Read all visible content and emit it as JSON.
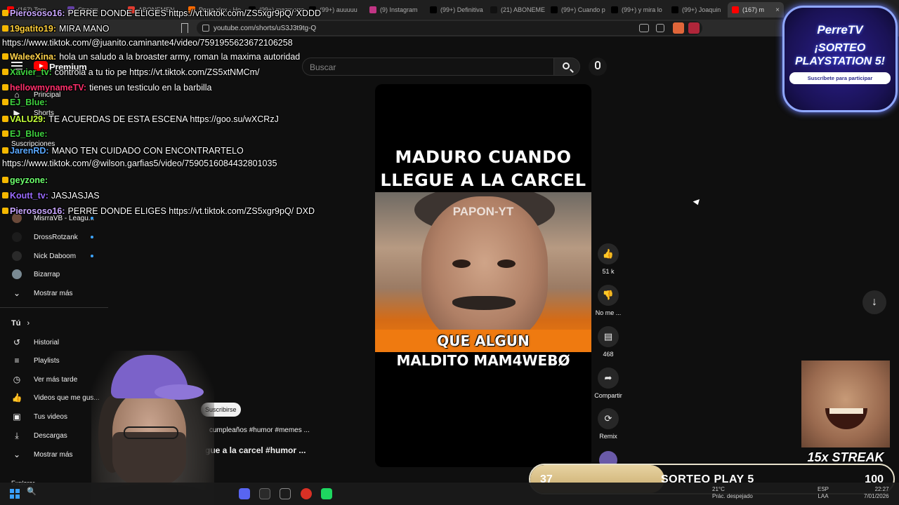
{
  "browser": {
    "tabs": [
      {
        "label": "(167) Torn"
      },
      {
        "label": "Stream"
      },
      {
        "label": "ABONEMEN"
      },
      {
        "label": "Perra xlox - Ho"
      },
      {
        "label": "(99+) mazmorra"
      },
      {
        "label": "(99+) auuuuu"
      },
      {
        "label": "(9) Instagram"
      },
      {
        "label": "(99+) Definitiva"
      },
      {
        "label": "(21) ABONEME"
      },
      {
        "label": "(99+) Cuando p"
      },
      {
        "label": "(99+) y mira lo"
      },
      {
        "label": "(99+) Joaquin"
      },
      {
        "label": "(167) m"
      }
    ],
    "url": "youtube.com/shorts/uS3J3t9tg-Q"
  },
  "youtube": {
    "premium_label": "Premium",
    "search_placeholder": "Buscar"
  },
  "sidebar": {
    "top_items": [
      {
        "label": "Principal"
      },
      {
        "label": "Shorts"
      },
      {
        "label": "Suscripciones"
      }
    ],
    "subscriptions": [
      {
        "label": "MisrraVB - Leagu..."
      },
      {
        "label": "DrossRotzank"
      },
      {
        "label": "Nick Daboom"
      },
      {
        "label": "Bizarrap"
      }
    ],
    "show_more": "Mostrar más",
    "you_section": "Tú",
    "you_items": [
      {
        "label": "Historial"
      },
      {
        "label": "Playlists"
      },
      {
        "label": "Ver más tarde"
      },
      {
        "label": "Videos que me gus..."
      },
      {
        "label": "Tus videos"
      },
      {
        "label": "Descargas"
      }
    ],
    "show_more_2": "Mostrar más",
    "explore": "Explorar"
  },
  "short": {
    "caption_top_1": "MADURO CUANDO",
    "caption_top_2": "LLEGUE A LA CARCEL",
    "watermark": "PAPON-YT",
    "caption_bottom_1": "QUE ALGUN",
    "caption_bottom_2": "MALDITO MAM4WEBØ"
  },
  "actions": {
    "like_count": "51 k",
    "dislike_label": "No me ...",
    "comments_count": "468",
    "share_label": "Compartir",
    "remix_label": "Remix"
  },
  "channel": {
    "subscribe_label": "Suscribirse",
    "title_line_1": "cumpleaños #humor #memes ...",
    "title_line_2": "o llegue a la carcel #humor ..."
  },
  "chat": [
    {
      "user": "Pierososo16:",
      "msg": "PERRE DONDE ELIGES https://vt.tiktok.com/ZS5xgr9pQ/ XDDD",
      "color": "#c9a6ff"
    },
    {
      "user": "19gatito19:",
      "msg": "MIRA MANO",
      "color": "#ffcf3a"
    },
    {
      "user": "",
      "msg": "https://www.tiktok.com/@juanito.caminante4/video/7591955623672106258",
      "color": "#ffffff"
    },
    {
      "user": "WaleeXina:",
      "msg": "hola un saludo a la broaster army, roman la maxima autoridad",
      "color": "#ffd24a"
    },
    {
      "user": "Xavier_tv:",
      "msg": "controla a tu tio pe https://vt.tiktok.com/ZS5xtNMCm/",
      "color": "#3fd13f"
    },
    {
      "user": "hellowmynameTV:",
      "msg": "tienes un testiculo en la barbilla",
      "color": "#ff2f6b"
    },
    {
      "user": "EJ_Blue:",
      "msg": "",
      "color": "#3fd13f"
    },
    {
      "user": "VALU29:",
      "msg": "TE ACUERDAS DE ESTA ESCENA https://goo.su/wXCRzJ",
      "color": "#c4ff3a"
    },
    {
      "user": "EJ_Blue:",
      "msg": "",
      "color": "#3fd13f"
    },
    {
      "user": "JarenRD:",
      "msg": "MANO TEN CUIDADO CON ENCONTRARTELO",
      "color": "#5aa8ff"
    },
    {
      "user": "",
      "msg": "https://www.tiktok.com/@wilson.garfias5/video/7590516084432801035",
      "color": "#ffffff"
    },
    {
      "user": "geyzone:",
      "msg": "",
      "color": "#6dff6d"
    },
    {
      "user": "Koutt_tv:",
      "msg": "JASJASJAS",
      "color": "#9a6bff"
    },
    {
      "user": "Pierososo16:",
      "msg": "PERRE DONDE ELIGES https://vt.tiktok.com/ZS5xgr9pQ/ DXD",
      "color": "#c9a6ff"
    }
  ],
  "sorteo_badge": {
    "brand": "PerreTV",
    "title": "¡SORTEO PLAYSTATION 5!",
    "subtitle": "Suscríbete para participar"
  },
  "streak": {
    "label": "15x STREAK"
  },
  "progress": {
    "current": "37",
    "label": "SORTEO PLAY 5",
    "max": "100",
    "fraction": 0.37
  },
  "taskbar": {
    "temperature": "21°C",
    "weather": "Prác. despejado",
    "lang_1": "ESP",
    "lang_2": "LAA",
    "time": "22:27",
    "date": "7/01/2026"
  }
}
